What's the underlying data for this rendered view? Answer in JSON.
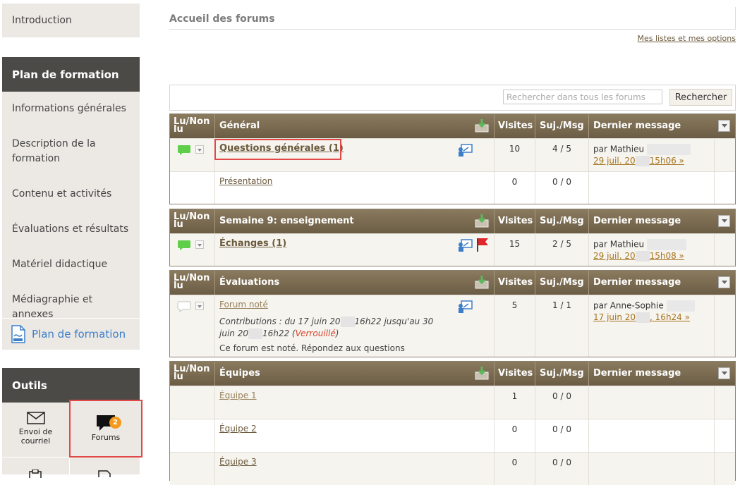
{
  "sidebar": {
    "intro": "Introduction",
    "plan_header": "Plan de formation",
    "items": [
      "Informations générales",
      "Description de la formation",
      "Contenu et activités",
      "Évaluations et résultats",
      "Matériel didactique",
      "Médiagraphie et annexes"
    ],
    "pdf_link": "Plan de formation",
    "tools_header": "Outils",
    "tools": {
      "mail": "Envoi de courriel",
      "forums": "Forums",
      "forums_badge": "2"
    }
  },
  "main": {
    "title": "Accueil des forums",
    "options_link": "Mes listes et mes options",
    "search": {
      "placeholder": "Rechercher dans tous les forums",
      "button": "Rechercher"
    },
    "headers": {
      "lu_nonlu": "Lu/Non lu",
      "visits": "Visites",
      "suj_msg": "Suj./Msg",
      "last": "Dernier message"
    },
    "sections": [
      {
        "title": "Général",
        "rows": [
          {
            "name": "Questions générales",
            "count": "(1)",
            "visits": "10",
            "suj": "4 / 5",
            "by": "par Mathieu",
            "date_a": "29 juil. 20",
            "date_b": "15h06 »"
          },
          {
            "name": "Présentation",
            "visits": "0",
            "suj": "0 / 0"
          }
        ]
      },
      {
        "title": "Semaine 9: enseignement",
        "rows": [
          {
            "name": "Échanges",
            "count": "(1)",
            "visits": "15",
            "suj": "2 / 5",
            "by": "par Mathieu",
            "date_a": "29 juil. 20",
            "date_b": "15h08 »"
          }
        ]
      },
      {
        "title": "Évaluations",
        "rows": [
          {
            "name": "Forum noté",
            "contrib_a": "Contributions : du 17 juin 20",
            "contrib_b": "16h22 jusqu'au 30 juin 20",
            "contrib_c": "16h22 (",
            "locked": "Verrouillé",
            "contrib_d": ")",
            "note": "Ce forum est noté. Répondez aux questions",
            "visits": "5",
            "suj": "1 / 1",
            "by": "par Anne-Sophie",
            "date_a": "17 juin 20",
            "date_b": ", 16h24 »"
          }
        ]
      },
      {
        "title": "Équipes",
        "rows": [
          {
            "name": "Équipe 1",
            "visits": "1",
            "suj": "0 / 0"
          },
          {
            "name": "Équipe 2",
            "visits": "0",
            "suj": "0 / 0"
          },
          {
            "name": "Équipe 3",
            "visits": "0",
            "suj": "0 / 0"
          }
        ]
      }
    ]
  },
  "colors": {
    "header_brown": "#7a6c52",
    "link_brown": "#6b5a3c",
    "date_gold": "#a6741f",
    "highlight_red": "#e34848",
    "badge_orange": "#f39a1d",
    "sidebar_dark": "#4b4a47"
  }
}
